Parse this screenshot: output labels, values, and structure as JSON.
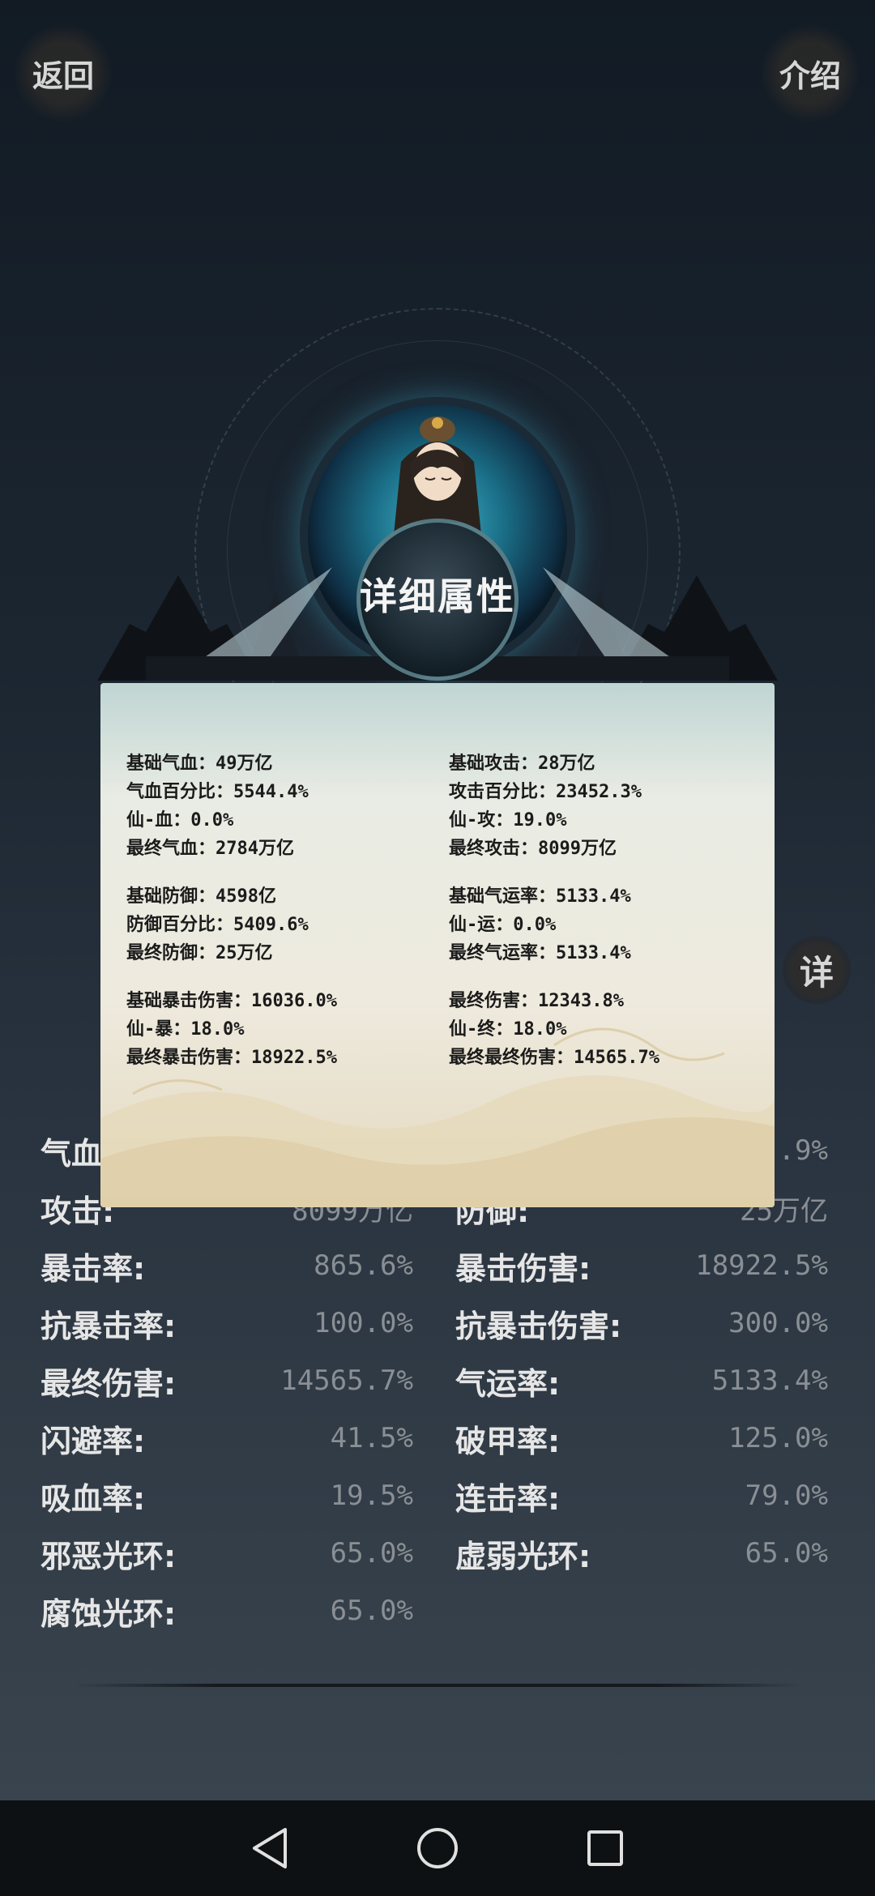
{
  "header": {
    "back_label": "返回",
    "intro_label": "介绍"
  },
  "panel": {
    "title": "详细属性"
  },
  "side_button_label": "详",
  "detail_groups": [
    {
      "left": [
        "基础气血：49万亿",
        "气血百分比：5544.4%",
        "仙-血：0.0%",
        "最终气血：2784万亿"
      ],
      "right": [
        "基础攻击：28万亿",
        "攻击百分比：23452.3%",
        "仙-攻：19.0%",
        "最终攻击：8099万亿"
      ]
    },
    {
      "left": [
        "基础防御：4598亿",
        "防御百分比：5409.6%",
        "最终防御：25万亿"
      ],
      "right": [
        "基础气运率：5133.4%",
        "仙-运：0.0%",
        "最终气运率：5133.4%"
      ]
    },
    {
      "left": [
        "基础暴击伤害：16036.0%",
        "仙-暴：18.0%",
        "最终暴击伤害：18922.5%"
      ],
      "right": [
        "最终伤害：12343.8%",
        "仙-终：18.0%",
        "最终最终伤害：14565.7%"
      ]
    }
  ],
  "base_stats": [
    {
      "left": {
        "label": "气血",
        "value": ""
      },
      "right": {
        "label": "",
        "value": ".9%"
      }
    },
    {
      "left": {
        "label": "攻击:",
        "value": "8099万亿"
      },
      "right": {
        "label": "防御:",
        "value": "25万亿"
      }
    },
    {
      "left": {
        "label": "暴击率:",
        "value": "865.6%"
      },
      "right": {
        "label": "暴击伤害:",
        "value": "18922.5%"
      }
    },
    {
      "left": {
        "label": "抗暴击率:",
        "value": "100.0%"
      },
      "right": {
        "label": "抗暴击伤害:",
        "value": "300.0%"
      }
    },
    {
      "left": {
        "label": "最终伤害:",
        "value": "14565.7%"
      },
      "right": {
        "label": "气运率:",
        "value": "5133.4%"
      }
    },
    {
      "left": {
        "label": "闪避率:",
        "value": "41.5%"
      },
      "right": {
        "label": "破甲率:",
        "value": "125.0%"
      }
    },
    {
      "left": {
        "label": "吸血率:",
        "value": "19.5%"
      },
      "right": {
        "label": "连击率:",
        "value": "79.0%"
      }
    },
    {
      "left": {
        "label": "邪恶光环:",
        "value": "65.0%"
      },
      "right": {
        "label": "虚弱光环:",
        "value": "65.0%"
      }
    },
    {
      "left": {
        "label": "腐蚀光环:",
        "value": "65.0%"
      },
      "right": {
        "label": "",
        "value": ""
      }
    }
  ],
  "nav": [
    "back-triangle-icon",
    "home-circle-icon",
    "recents-square-icon"
  ]
}
